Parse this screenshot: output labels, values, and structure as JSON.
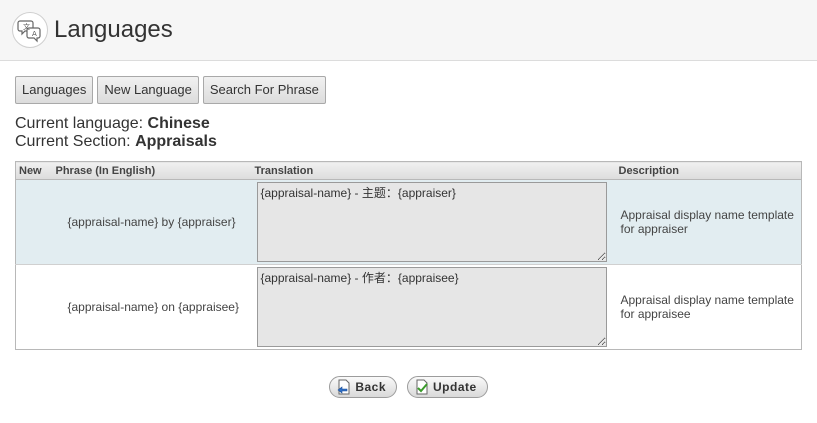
{
  "header": {
    "title": "Languages",
    "icon": "speech-bubbles-translate-icon"
  },
  "tabs": [
    {
      "label": "Languages"
    },
    {
      "label": "New Language"
    },
    {
      "label": "Search For Phrase"
    }
  ],
  "info": {
    "language_label": "Current language: ",
    "language_value": "Chinese",
    "section_label": "Current Section: ",
    "section_value": "Appraisals"
  },
  "table": {
    "headers": {
      "new": "New",
      "phrase": "Phrase (In English)",
      "translation": "Translation",
      "description": "Description"
    },
    "rows": [
      {
        "phrase": "{appraisal-name} by {appraiser}",
        "translation": "{appraisal-name} - 主题：{appraiser}",
        "description": "Appraisal display name template for appraiser"
      },
      {
        "phrase": "{appraisal-name} on {appraisee}",
        "translation": "{appraisal-name} - 作者：{appraisee}",
        "description": "Appraisal display name template for appraisee"
      }
    ]
  },
  "actions": {
    "back_label": "Back",
    "update_label": "Update"
  }
}
